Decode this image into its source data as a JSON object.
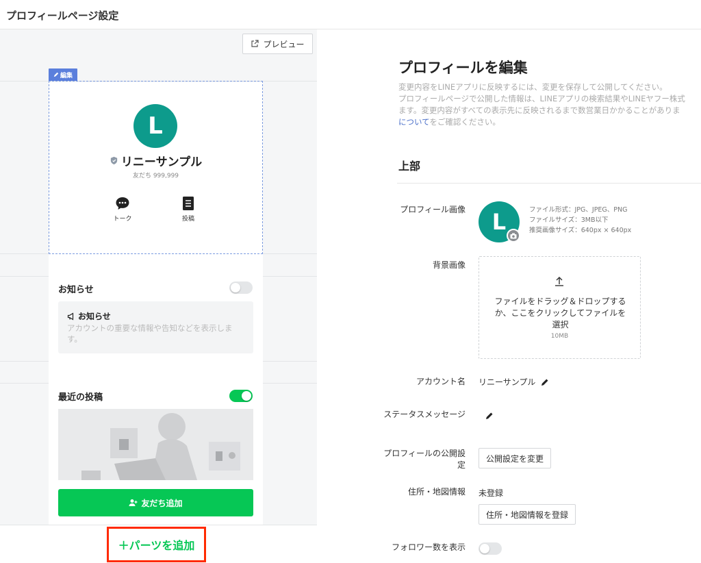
{
  "header": {
    "title": "プロフィールページ設定"
  },
  "preview_pane": {
    "preview_button": "プレビュー",
    "edit_tag": "編集",
    "avatar_letter": "L",
    "account_name": "リニーサンプル",
    "friends_count": "友だち 999,999",
    "actions": [
      {
        "label": "トーク",
        "icon": "chat-bubble-icon"
      },
      {
        "label": "投稿",
        "icon": "post-document-icon"
      }
    ],
    "notice_section": {
      "title": "お知らせ",
      "enabled": false,
      "box_title": "お知らせ",
      "box_desc": "アカウントの重要な情報や告知などを表示します。"
    },
    "recent_posts_section": {
      "title": "最近の投稿",
      "enabled": true
    },
    "add_friend_button": "友だち追加",
    "add_parts_button": "＋パーツを追加"
  },
  "edit_pane": {
    "title": "プロフィールを編集",
    "description_lines": [
      "変更内容をLINEアプリに反映するには、変更を保存して公開してください。",
      "プロフィールページで公開した情報は、LINEアプリの検索結果やLINEヤフー株式",
      "ます。変更内容がすべての表示先に反映されるまで数営業日かかることがありま"
    ],
    "description_link": "について",
    "description_tail": "をご確認ください。",
    "section_title": "上部",
    "profile_image": {
      "label": "プロフィール画像",
      "avatar_letter": "L",
      "info": [
        "ファイル形式：JPG、JPEG、PNG",
        "ファイルサイズ：3MB以下",
        "推奨画像サイズ：640px × 640px"
      ]
    },
    "background_image": {
      "label": "背景画像",
      "dropzone_text": "ファイルをドラッグ＆ドロップするか、ここをクリックしてファイルを選択",
      "max_size": "10MB"
    },
    "account_name": {
      "label": "アカウント名",
      "value": "リニーサンプル"
    },
    "status_message": {
      "label": "ステータスメッセージ"
    },
    "visibility": {
      "label": "プロフィールの公開設定",
      "button": "公開設定を変更"
    },
    "address": {
      "label": "住所・地図情報",
      "value": "未登録",
      "button": "住所・地図情報を登録"
    },
    "followers": {
      "label": "フォロワー数を表示",
      "enabled": false
    }
  },
  "colors": {
    "line_green": "#06c755",
    "avatar_teal": "#0d9b8c",
    "edit_tag_blue": "#5b7fdc",
    "highlight_red": "#ff2a00"
  }
}
